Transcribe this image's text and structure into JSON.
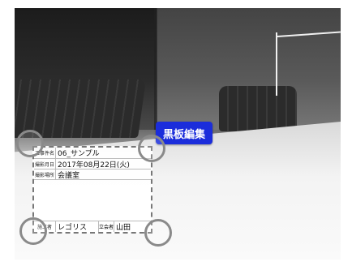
{
  "edit_button": {
    "label": "黒板編集"
  },
  "board": {
    "rows": [
      {
        "label": "工事件名",
        "value": "06_サンプル"
      },
      {
        "label": "撮影月日",
        "value": "2017年08月22日(火)"
      },
      {
        "label": "撮影場所",
        "value": "会議室"
      }
    ],
    "footer": {
      "contractor_label": "施工者",
      "contractor_value": "レゴリス",
      "witness_label": "立会者",
      "witness_value": "山田"
    }
  }
}
